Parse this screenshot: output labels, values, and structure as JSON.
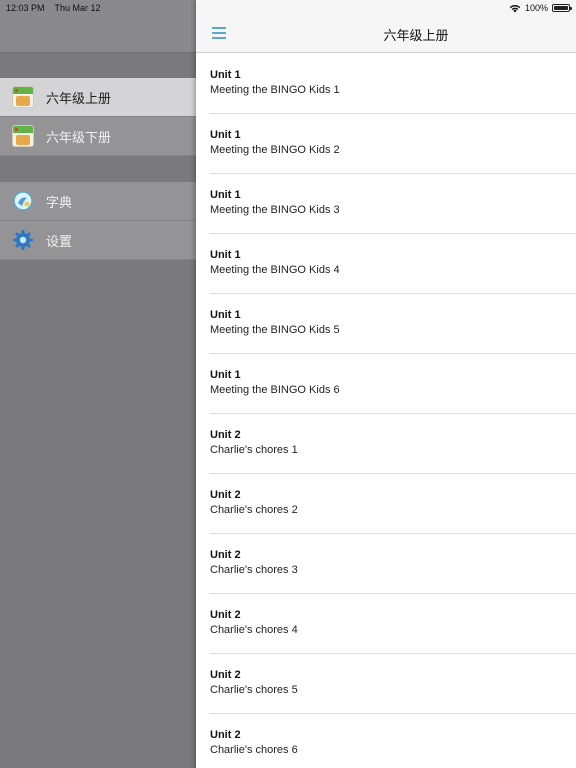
{
  "status_bar": {
    "time": "12:03 PM",
    "date": "Thu Mar 12",
    "battery": "100%"
  },
  "menu": {
    "books": [
      {
        "label": "六年级上册",
        "icon": "book-cover-icon",
        "selected": true
      },
      {
        "label": "六年级下册",
        "icon": "book-cover-icon",
        "selected": false
      }
    ],
    "tools": [
      {
        "label": "字典",
        "icon": "dictionary-icon"
      },
      {
        "label": "设置",
        "icon": "gear-icon"
      }
    ]
  },
  "navbar": {
    "title": "六年级上册",
    "menu_icon": "hamburger-icon"
  },
  "lessons": [
    {
      "unit": "Unit 1",
      "title": "Meeting the BINGO Kids 1"
    },
    {
      "unit": "Unit 1",
      "title": "Meeting the BINGO Kids 2"
    },
    {
      "unit": "Unit 1",
      "title": "Meeting the BINGO Kids 3"
    },
    {
      "unit": "Unit 1",
      "title": "Meeting the BINGO Kids 4"
    },
    {
      "unit": "Unit 1",
      "title": "Meeting the BINGO Kids 5"
    },
    {
      "unit": "Unit 1",
      "title": "Meeting the BINGO Kids 6"
    },
    {
      "unit": "Unit 2",
      "title": "Charlie's chores 1"
    },
    {
      "unit": "Unit 2",
      "title": "Charlie's chores 2"
    },
    {
      "unit": "Unit 2",
      "title": "Charlie's chores 3"
    },
    {
      "unit": "Unit 2",
      "title": "Charlie's chores 4"
    },
    {
      "unit": "Unit 2",
      "title": "Charlie's chores 5"
    },
    {
      "unit": "Unit 2",
      "title": "Charlie's chores 6"
    }
  ],
  "colors": {
    "accent": "#5aa9c9",
    "menu_bg": "#7a7a7c",
    "selected_bg": "#d4d4d6"
  }
}
